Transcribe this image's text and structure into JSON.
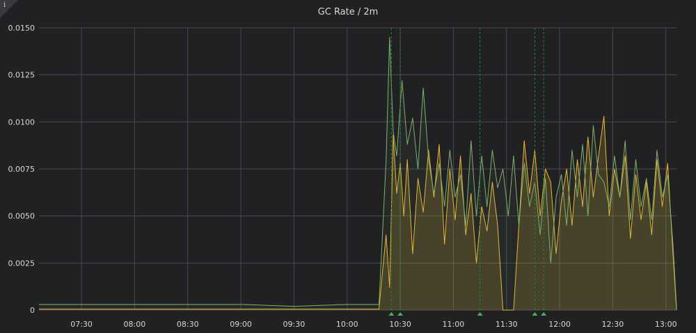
{
  "panel": {
    "title": "GC Rate / 2m",
    "info_icon": "i",
    "colors": {
      "background": "#212124",
      "grid": "#4a4a4e",
      "text": "#d8d9da",
      "series_green": "#7eb26d",
      "series_yellow": "#eab839",
      "annotation": "#1f8a3a"
    }
  },
  "chart_data": {
    "type": "area",
    "title": "GC Rate / 2m",
    "xlabel": "",
    "ylabel": "",
    "xlim": [
      "07:06",
      "13:06"
    ],
    "ylim": [
      0,
      0.015
    ],
    "grid": true,
    "legend": "none",
    "y_ticks": [
      "0",
      "0.0025",
      "0.0050",
      "0.0075",
      "0.0100",
      "0.0125",
      "0.0150"
    ],
    "x_ticks": [
      "07:30",
      "08:00",
      "08:30",
      "09:00",
      "09:30",
      "10:00",
      "10:30",
      "11:00",
      "11:30",
      "12:00",
      "12:30",
      "13:00"
    ],
    "annotations": [
      "10:25",
      "10:30",
      "11:15",
      "11:46",
      "11:51"
    ],
    "series": [
      {
        "color": "#7eb26d",
        "fill": false,
        "points": [
          [
            "07:06",
            0.0003
          ],
          [
            "07:30",
            0.0003
          ],
          [
            "08:00",
            0.0003
          ],
          [
            "08:30",
            0.0003
          ],
          [
            "09:00",
            0.0003
          ],
          [
            "09:30",
            0.0002
          ],
          [
            "10:00",
            0.0003
          ],
          [
            "10:18",
            0.0003
          ],
          [
            "10:22",
            0.0079
          ],
          [
            "10:24",
            0.0145
          ],
          [
            "10:26",
            0.0095
          ],
          [
            "10:28",
            0.0082
          ],
          [
            "10:31",
            0.0122
          ],
          [
            "10:34",
            0.0088
          ],
          [
            "10:37",
            0.0102
          ],
          [
            "10:40",
            0.0075
          ],
          [
            "10:43",
            0.0118
          ],
          [
            "10:46",
            0.008
          ],
          [
            "10:49",
            0.0062
          ],
          [
            "10:52",
            0.0078
          ],
          [
            "10:55",
            0.0055
          ],
          [
            "10:58",
            0.0085
          ],
          [
            "11:01",
            0.006
          ],
          [
            "11:04",
            0.0072
          ],
          [
            "11:07",
            0.0045
          ],
          [
            "11:10",
            0.009
          ],
          [
            "11:13",
            0.005
          ],
          [
            "11:16",
            0.0082
          ],
          [
            "11:19",
            0.0055
          ],
          [
            "11:22",
            0.0085
          ],
          [
            "11:25",
            0.0065
          ],
          [
            "11:28",
            0.0075
          ],
          [
            "11:31",
            0.005
          ],
          [
            "11:34",
            0.0082
          ],
          [
            "11:37",
            0.0045
          ],
          [
            "11:40",
            0.0078
          ],
          [
            "11:43",
            0.0055
          ],
          [
            "11:46",
            0.0068
          ],
          [
            "11:49",
            0.004
          ],
          [
            "11:52",
            0.007
          ],
          [
            "11:55",
            0.0025
          ],
          [
            "11:58",
            0.006
          ],
          [
            "12:01",
            0.0072
          ],
          [
            "12:04",
            0.0045
          ],
          [
            "12:07",
            0.0085
          ],
          [
            "12:10",
            0.006
          ],
          [
            "12:13",
            0.0088
          ],
          [
            "12:16",
            0.005
          ],
          [
            "12:19",
            0.0098
          ],
          [
            "12:22",
            0.0072
          ],
          [
            "12:25",
            0.0068
          ],
          [
            "12:28",
            0.0055
          ],
          [
            "12:31",
            0.0082
          ],
          [
            "12:34",
            0.006
          ],
          [
            "12:37",
            0.009
          ],
          [
            "12:40",
            0.0048
          ],
          [
            "12:43",
            0.008
          ],
          [
            "12:46",
            0.0055
          ],
          [
            "12:49",
            0.007
          ],
          [
            "12:52",
            0.0048
          ],
          [
            "12:55",
            0.0085
          ],
          [
            "12:58",
            0.006
          ],
          [
            "13:01",
            0.0072
          ],
          [
            "13:04",
            0.0035
          ],
          [
            "13:06",
            0.0002
          ]
        ]
      },
      {
        "color": "#eab839",
        "fill": true,
        "points": [
          [
            "07:06",
            5e-05
          ],
          [
            "08:00",
            5e-05
          ],
          [
            "09:00",
            5e-05
          ],
          [
            "10:00",
            5e-05
          ],
          [
            "10:18",
            5e-05
          ],
          [
            "10:22",
            0.004
          ],
          [
            "10:24",
            0.0012
          ],
          [
            "10:26",
            0.0093
          ],
          [
            "10:28",
            0.0062
          ],
          [
            "10:30",
            0.0078
          ],
          [
            "10:32",
            0.005
          ],
          [
            "10:34",
            0.008
          ],
          [
            "10:37",
            0.003
          ],
          [
            "10:40",
            0.007
          ],
          [
            "10:43",
            0.0052
          ],
          [
            "10:46",
            0.0085
          ],
          [
            "10:49",
            0.006
          ],
          [
            "10:52",
            0.0088
          ],
          [
            "10:55",
            0.0035
          ],
          [
            "10:58",
            0.0075
          ],
          [
            "11:01",
            0.0048
          ],
          [
            "11:04",
            0.0082
          ],
          [
            "11:07",
            0.004
          ],
          [
            "11:10",
            0.0062
          ],
          [
            "11:13",
            0.0025
          ],
          [
            "11:16",
            0.0055
          ],
          [
            "11:19",
            0.0042
          ],
          [
            "11:22",
            0.0068
          ],
          [
            "11:25",
            0.0045
          ],
          [
            "11:28",
            0.0
          ],
          [
            "11:34",
            0.0
          ],
          [
            "11:37",
            0.0045
          ],
          [
            "11:40",
            0.009
          ],
          [
            "11:43",
            0.0062
          ],
          [
            "11:46",
            0.0085
          ],
          [
            "11:49",
            0.005
          ],
          [
            "11:52",
            0.0075
          ],
          [
            "11:55",
            0.0068
          ],
          [
            "11:58",
            0.003
          ],
          [
            "12:01",
            0.0058
          ],
          [
            "12:04",
            0.0075
          ],
          [
            "12:07",
            0.0045
          ],
          [
            "12:10",
            0.008
          ],
          [
            "12:13",
            0.0055
          ],
          [
            "12:16",
            0.0092
          ],
          [
            "12:19",
            0.006
          ],
          [
            "12:22",
            0.0082
          ],
          [
            "12:25",
            0.0103
          ],
          [
            "12:28",
            0.005
          ],
          [
            "12:31",
            0.0075
          ],
          [
            "12:34",
            0.006
          ],
          [
            "12:37",
            0.0082
          ],
          [
            "12:40",
            0.0038
          ],
          [
            "12:43",
            0.0072
          ],
          [
            "12:46",
            0.0048
          ],
          [
            "12:49",
            0.0068
          ],
          [
            "12:52",
            0.004
          ],
          [
            "12:55",
            0.008
          ],
          [
            "12:58",
            0.0055
          ],
          [
            "13:01",
            0.0078
          ],
          [
            "13:04",
            0.003
          ],
          [
            "13:06",
            0.0
          ]
        ]
      }
    ]
  }
}
